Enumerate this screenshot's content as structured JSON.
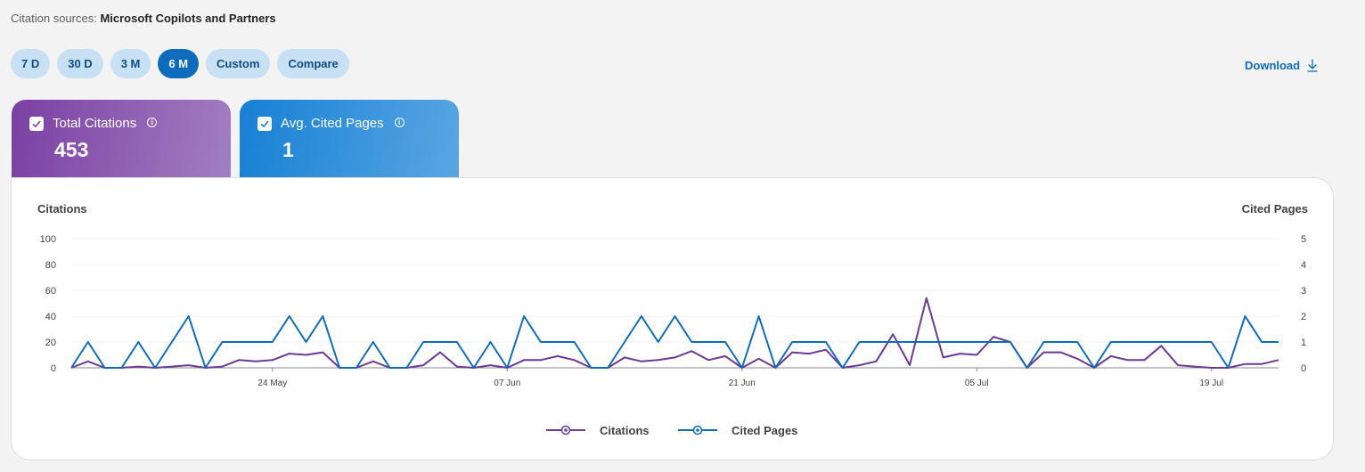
{
  "header": {
    "source_label": "Citation sources:",
    "source_value": "Microsoft Copilots and Partners"
  },
  "range_buttons": [
    {
      "label": "7 D",
      "active": false
    },
    {
      "label": "30 D",
      "active": false
    },
    {
      "label": "3 M",
      "active": false
    },
    {
      "label": "6 M",
      "active": true
    },
    {
      "label": "Custom",
      "active": false
    },
    {
      "label": "Compare",
      "active": false
    }
  ],
  "download": {
    "label": "Download",
    "icon": "download-arrow-icon"
  },
  "metrics": {
    "citations": {
      "label": "Total Citations",
      "value": "453",
      "checked": true,
      "info_icon": "info-icon",
      "gradient": [
        "#7b3fa3",
        "#a27fc1"
      ]
    },
    "pages": {
      "label": "Avg. Cited Pages",
      "value": "1",
      "checked": true,
      "info_icon": "info-icon",
      "gradient": [
        "#1680d4",
        "#5aa6e3"
      ]
    }
  },
  "chart_data": {
    "type": "line",
    "left_axis_title": "Citations",
    "right_axis_title": "Cited Pages",
    "y_left_lim": [
      0,
      100
    ],
    "y_right_lim": [
      0,
      5
    ],
    "y_left_ticks": [
      "0",
      "20",
      "40",
      "60",
      "80",
      "100"
    ],
    "y_right_ticks": [
      "0",
      "1",
      "2",
      "3",
      "4",
      "5"
    ],
    "x_tick_labels": [
      {
        "index": 12,
        "label": "24 May"
      },
      {
        "index": 26,
        "label": "07 Jun"
      },
      {
        "index": 40,
        "label": "21 Jun"
      },
      {
        "index": 54,
        "label": "05 Jul"
      },
      {
        "index": 68,
        "label": "19 Jul"
      }
    ],
    "grid": "horizontal",
    "legend_position": "bottom",
    "series": [
      {
        "name": "Citations",
        "axis": "left",
        "color": "#6b3a96",
        "values": [
          0,
          5,
          0,
          0,
          1,
          0,
          1,
          2,
          0,
          1,
          6,
          5,
          6,
          11,
          10,
          12,
          0,
          0,
          5,
          0,
          0,
          2,
          12,
          1,
          0,
          2,
          0,
          6,
          6,
          9,
          6,
          0,
          0,
          8,
          5,
          6,
          8,
          13,
          6,
          9,
          0,
          7,
          0,
          12,
          11,
          14,
          0,
          2,
          5,
          26,
          2,
          54,
          8,
          11,
          10,
          24,
          20,
          0,
          12,
          12,
          7,
          0,
          9,
          6,
          6,
          17,
          2,
          1,
          0,
          0,
          3,
          3,
          6
        ]
      },
      {
        "name": "Cited Pages",
        "axis": "right",
        "color": "#0f6cbd",
        "values": [
          0,
          1,
          0,
          0,
          1,
          0,
          1,
          2,
          0,
          1,
          1,
          1,
          1,
          2,
          1,
          2,
          0,
          0,
          1,
          0,
          0,
          1,
          1,
          1,
          0,
          1,
          0,
          2,
          1,
          1,
          1,
          0,
          0,
          1,
          2,
          1,
          2,
          1,
          1,
          1,
          0,
          2,
          0,
          1,
          1,
          1,
          0,
          1,
          1,
          1,
          1,
          1,
          1,
          1,
          1,
          1,
          1,
          0,
          1,
          1,
          1,
          0,
          1,
          1,
          1,
          1,
          1,
          1,
          1,
          0,
          2,
          1,
          1
        ]
      }
    ]
  }
}
